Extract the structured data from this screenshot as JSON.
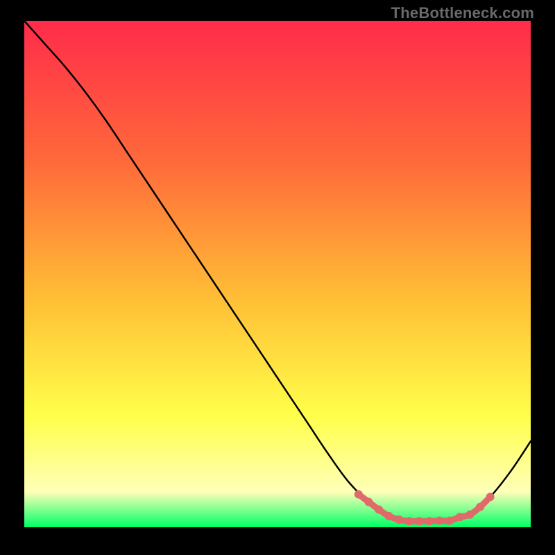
{
  "watermark": "TheBottleneck.com",
  "colors": {
    "background": "#000000",
    "gradient_top": "#ff2b4a",
    "gradient_mid1": "#ff6a3a",
    "gradient_mid2": "#ffbf36",
    "gradient_mid3": "#ffff4a",
    "gradient_mid35": "#ffffb8",
    "gradient_bottom": "#00ff66",
    "curve": "#000000",
    "highlight": "#e06a6a"
  },
  "chart_data": {
    "type": "line",
    "title": "",
    "xlabel": "",
    "ylabel": "",
    "xlim": [
      0,
      100
    ],
    "ylim": [
      0,
      100
    ],
    "grid": false,
    "legend": false,
    "series": [
      {
        "name": "bottleneck-curve",
        "x": [
          0,
          4,
          8,
          12,
          16,
          20,
          24,
          28,
          32,
          36,
          40,
          44,
          48,
          52,
          56,
          60,
          64,
          68,
          72,
          76,
          80,
          84,
          88,
          92,
          96,
          100
        ],
        "y": [
          100,
          95.5,
          91,
          86,
          80.5,
          74.5,
          68.5,
          62.5,
          56.5,
          50.5,
          44.5,
          38.5,
          32.5,
          26.5,
          20.5,
          14.5,
          9,
          5,
          2.2,
          1.2,
          1.2,
          1.3,
          2.5,
          6,
          11,
          17
        ]
      },
      {
        "name": "optimal-highlight",
        "x": [
          66,
          68,
          70,
          72,
          74,
          76,
          78,
          80,
          82,
          84,
          86,
          88,
          90,
          92
        ],
        "y": [
          6.5,
          5,
          3.5,
          2.2,
          1.5,
          1.2,
          1.2,
          1.2,
          1.3,
          1.3,
          2.0,
          2.5,
          4.0,
          6.0
        ]
      }
    ]
  }
}
